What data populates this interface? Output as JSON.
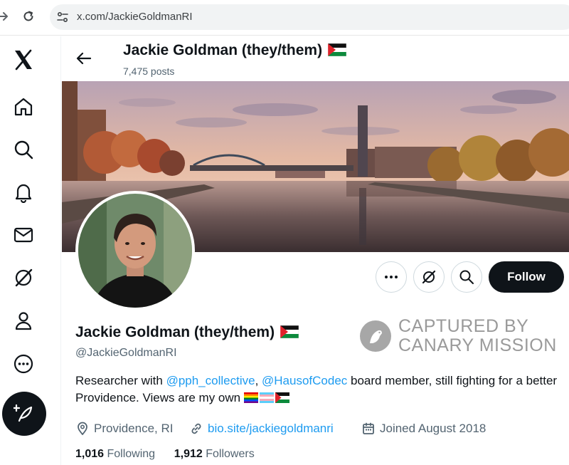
{
  "browser": {
    "url": "x.com/JackieGoldmanRI"
  },
  "nav": {
    "items": [
      "x-logo",
      "home",
      "explore",
      "notifications",
      "messages",
      "grok",
      "profile",
      "more"
    ],
    "compose_icon": "feather-plus-icon"
  },
  "header": {
    "name": "Jackie Goldman (they/them)",
    "posts": "7,475 posts"
  },
  "profile": {
    "name": "Jackie Goldman (they/them)",
    "handle": "@JackieGoldmanRI",
    "bio_pre": "Researcher with ",
    "mention1": "@pph_collective",
    "bio_sep": ", ",
    "mention2": "@HausofCodec",
    "bio_post": " board member, still fighting for a better Providence. Views are my own ",
    "location": "Providence, RI",
    "website": "bio.site/jackiegoldmanri",
    "joined": "Joined August 2018",
    "following_count": "1,016",
    "following_label": " Following",
    "followers_count": "1,912",
    "followers_label": " Followers"
  },
  "actions": {
    "more_icon": "more-horizontal-icon",
    "grok_icon": "grok-icon",
    "search_icon": "search-icon",
    "follow_label": "Follow"
  },
  "watermark": {
    "line1": "CAPTURED BY",
    "line2": "CANARY MISSION"
  },
  "colors": {
    "accent": "#1d9bf0",
    "text": "#0f1419",
    "secondary": "#536471"
  }
}
